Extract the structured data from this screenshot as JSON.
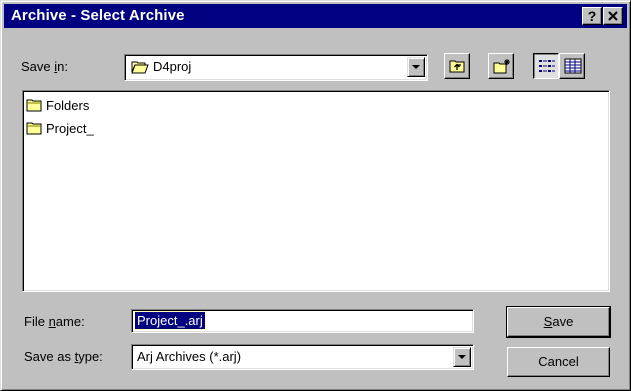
{
  "window": {
    "title": "Archive - Select Archive",
    "help_label": "?",
    "close_label": "✕"
  },
  "save_in": {
    "label_pre": "Save ",
    "label_u": "i",
    "label_post": "n:",
    "value": "D4proj"
  },
  "toolbar": {
    "buttons": [
      {
        "name": "up-one-level-button",
        "icon": "folder-up-icon"
      },
      {
        "name": "create-new-folder-button",
        "icon": "new-folder-icon"
      },
      {
        "name": "list-view-button",
        "icon": "list-view-icon",
        "pressed": true
      },
      {
        "name": "details-view-button",
        "icon": "details-view-icon"
      }
    ]
  },
  "file_list": {
    "items": [
      {
        "label": "Folders",
        "icon": "folder-icon"
      },
      {
        "label": "Project_",
        "icon": "folder-icon"
      }
    ]
  },
  "file_name": {
    "label_pre": "File ",
    "label_u": "n",
    "label_post": "ame:",
    "value": "Project_.arj"
  },
  "save_as_type": {
    "label_pre": "Save as ",
    "label_u": "t",
    "label_post": "ype:",
    "value": "Arj Archives (*.arj)"
  },
  "buttons": {
    "save_u": "S",
    "save_rest": "ave",
    "cancel": "Cancel"
  },
  "colors": {
    "title_bar": "#000080",
    "face": "#c0c0c0",
    "folder": "#ffff99"
  }
}
